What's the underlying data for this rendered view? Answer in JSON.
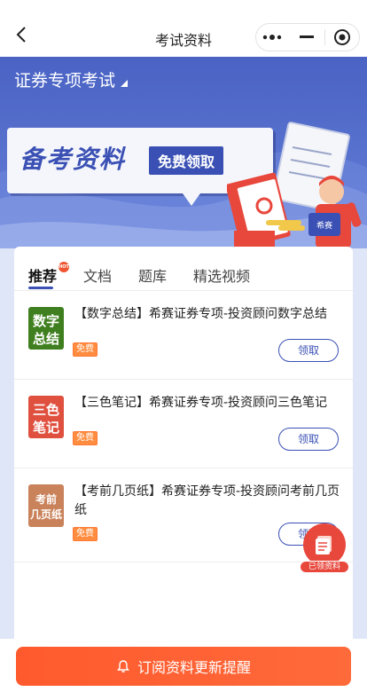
{
  "nav": {
    "title": "考试资料"
  },
  "exam": {
    "name": "证券专项考试"
  },
  "banner": {
    "headline": "备考资料",
    "tag": "免费领取",
    "mascot_sign": "希赛"
  },
  "tabs": [
    {
      "label": "推荐",
      "active": true,
      "badge": "HOT"
    },
    {
      "label": "文档",
      "active": false
    },
    {
      "label": "题库",
      "active": false
    },
    {
      "label": "精选视频",
      "active": false
    }
  ],
  "items": [
    {
      "thumb_line1": "数字",
      "thumb_line2": "总结",
      "thumb_color": "#3f7f1f",
      "title": "【数字总结】希赛证券专项-投资顾问数字总结",
      "tag": "免费",
      "action": "领取"
    },
    {
      "thumb_line1": "三色",
      "thumb_line2": "笔记",
      "thumb_color": "#e0503e",
      "title": "【三色笔记】希赛证券专项-投资顾问三色笔记",
      "tag": "免费",
      "action": "领取"
    },
    {
      "thumb_line1": "考前",
      "thumb_line2": "几页纸",
      "thumb_color": "#c9825a",
      "title": "【考前几页纸】希赛证券专项-投资顾问考前几页纸",
      "tag": "免费",
      "action": "领取"
    }
  ],
  "float_button": {
    "label": "已领资料"
  },
  "bottom": {
    "subscribe_label": "订阅资料更新提醒"
  },
  "colors": {
    "brand_blue": "#3a50b4",
    "accent_orange": "#ff5a2e"
  }
}
